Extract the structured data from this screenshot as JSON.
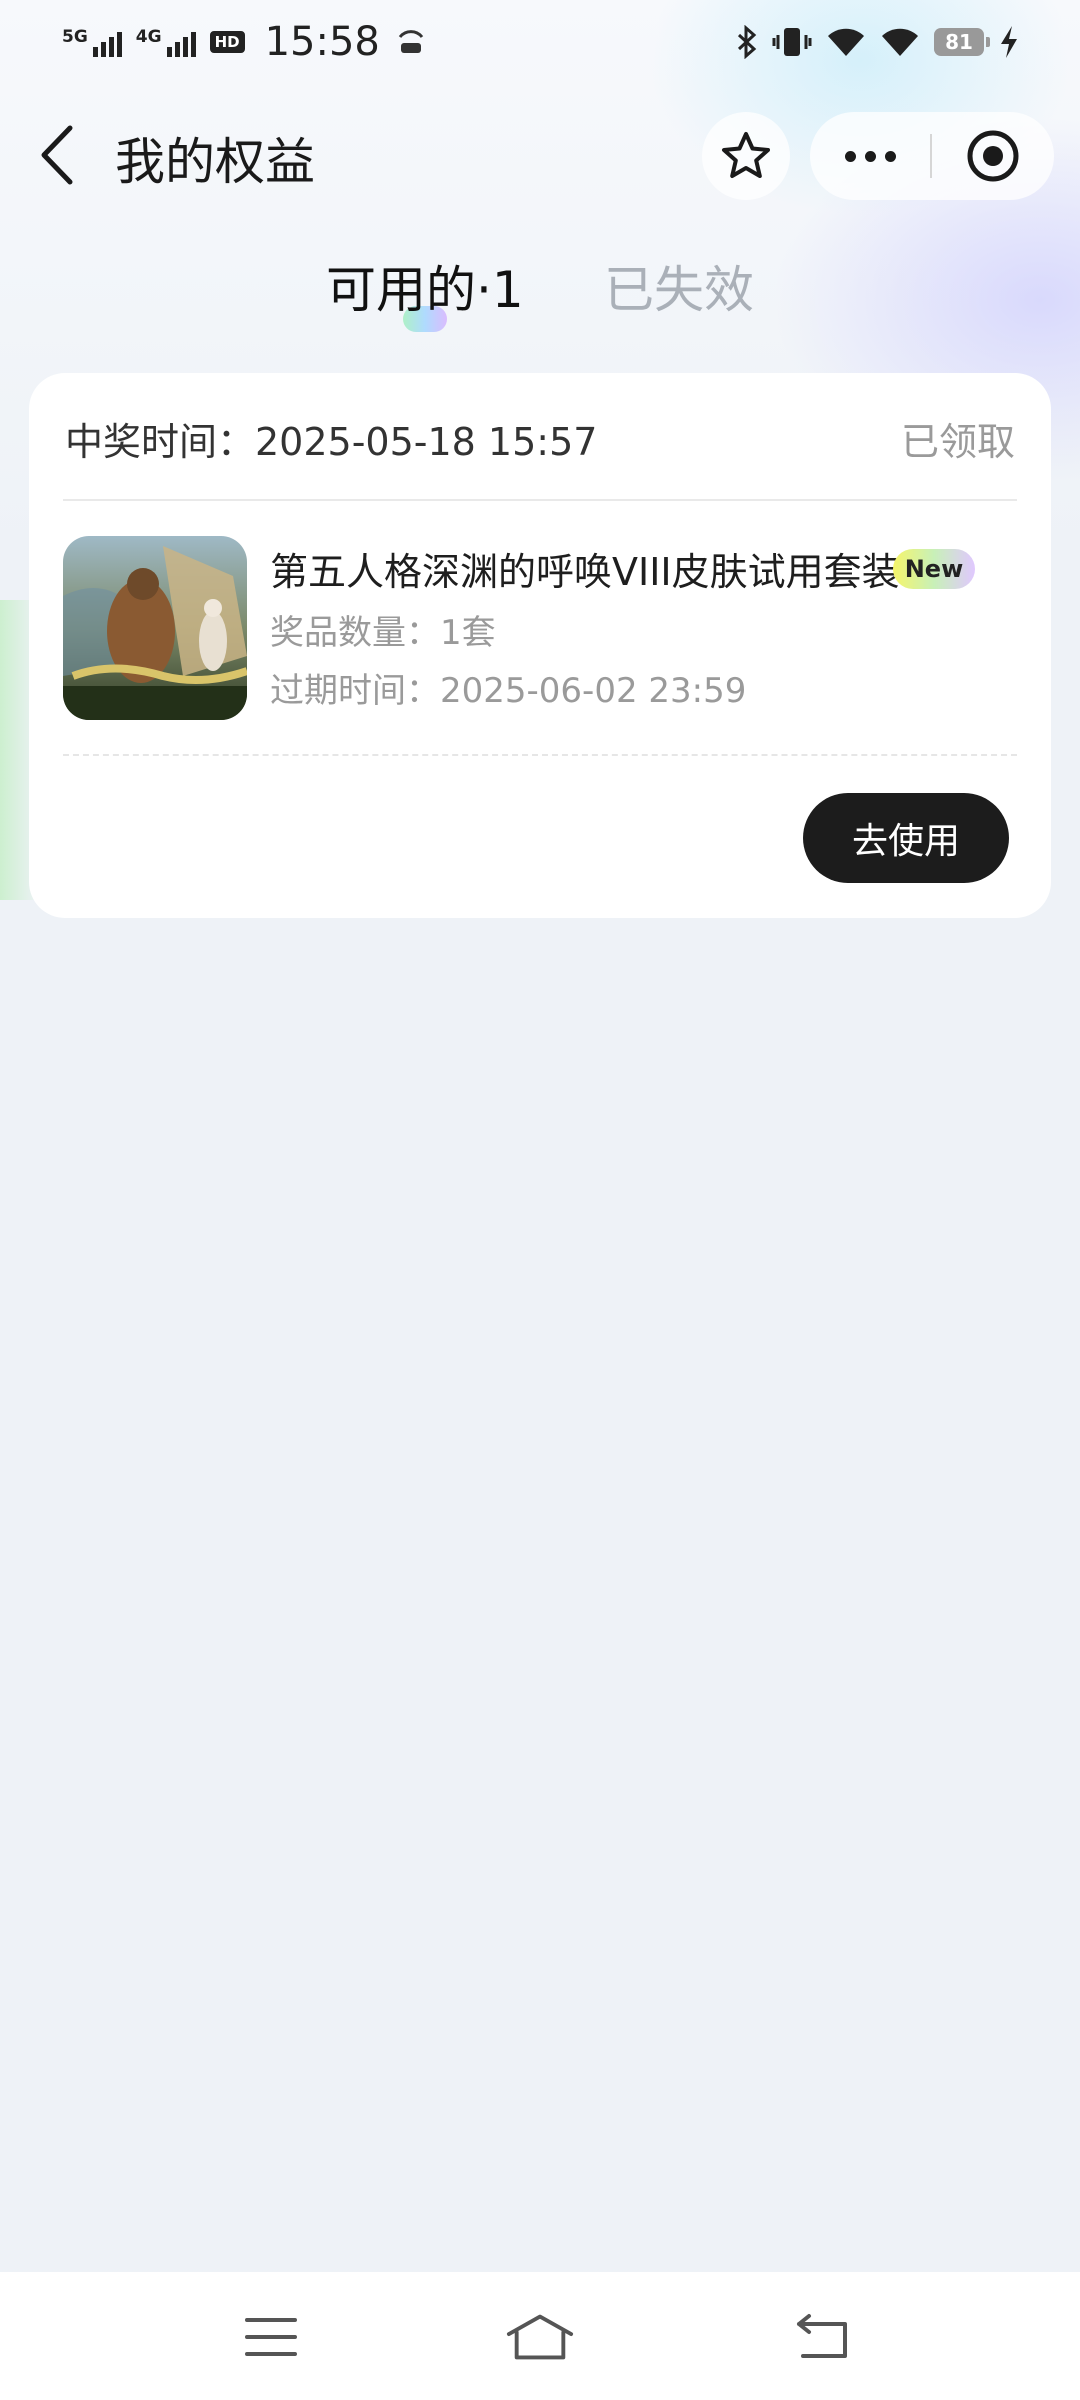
{
  "status_bar": {
    "net1": "5G",
    "net2": "4G",
    "hd": "HD",
    "time": "15:58",
    "battery": "81"
  },
  "header": {
    "title": "我的权益"
  },
  "tabs": {
    "active": "可用的·1",
    "inactive": "已失效"
  },
  "card": {
    "win_time_label": "中奖时间：2025-05-18 15:57",
    "status": "已领取",
    "prize_name": "第五人格深渊的呼唤VIII皮肤试用套装",
    "badge": "New",
    "quantity": "奖品数量：1套",
    "expire": "过期时间：2025-06-02 23:59",
    "use_button": "去使用"
  },
  "colors": {
    "accent_dark": "#1c1c1c",
    "muted_text": "#9a9a9a",
    "page_bg": "#eef2f7"
  }
}
